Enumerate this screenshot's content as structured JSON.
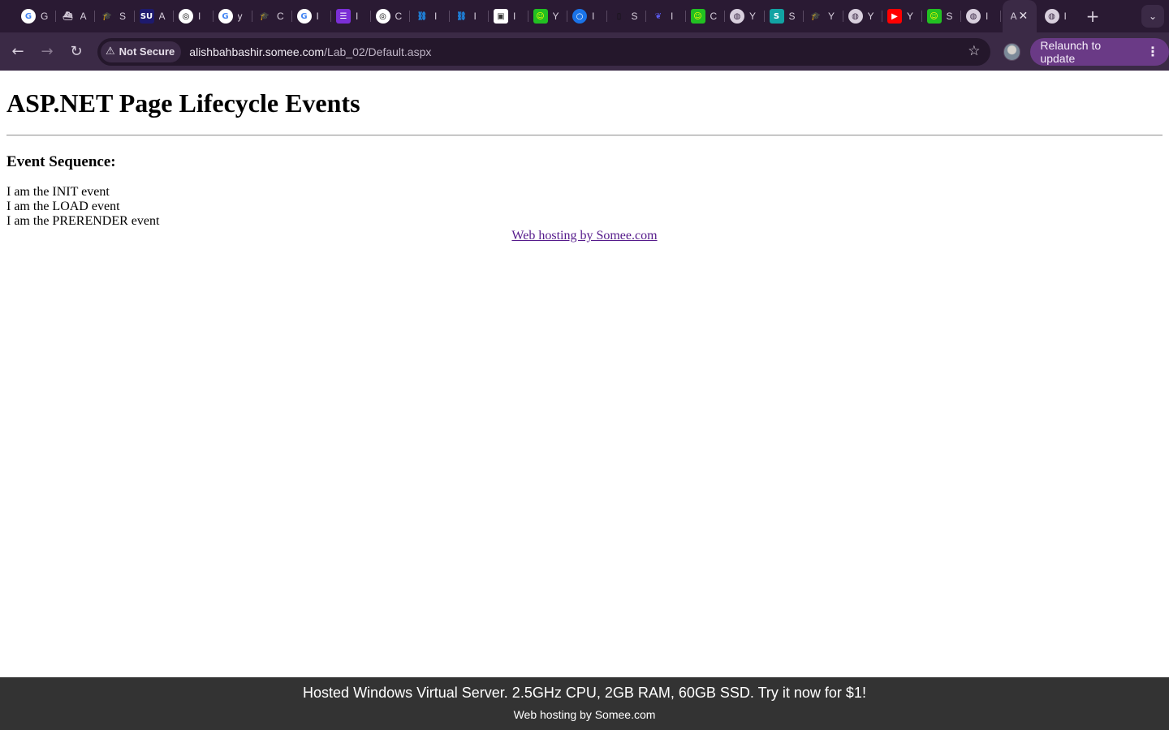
{
  "browser": {
    "tabs": [
      {
        "icon": "google-icon",
        "color": "#ffffff",
        "glyph": "G",
        "fg": "#4285f4",
        "title": "G"
      },
      {
        "icon": "ship-icon",
        "color": "#2a1a33",
        "glyph": "⛴",
        "fg": "#d8cfdd",
        "title": "A"
      },
      {
        "icon": "graduation-cap-icon",
        "color": "#2a1a33",
        "glyph": "🎓",
        "fg": "#2bb3c0",
        "title": "S"
      },
      {
        "icon": "su-logo-icon",
        "color": "#1e1a6e",
        "glyph": "SU",
        "fg": "#ffffff",
        "title": "A"
      },
      {
        "icon": "openai-icon",
        "color": "#ffffff",
        "glyph": "◎",
        "fg": "#000000",
        "title": "I"
      },
      {
        "icon": "google-icon",
        "color": "#ffffff",
        "glyph": "G",
        "fg": "#4285f4",
        "title": "y"
      },
      {
        "icon": "graduation-cap-icon",
        "color": "#2a1a33",
        "glyph": "🎓",
        "fg": "#2bb3c0",
        "title": "C"
      },
      {
        "icon": "google-icon",
        "color": "#ffffff",
        "glyph": "G",
        "fg": "#4285f4",
        "title": "I"
      },
      {
        "icon": "list-icon",
        "color": "#7b2fd6",
        "glyph": "☰",
        "fg": "#ffffff",
        "title": "I"
      },
      {
        "icon": "openai-icon",
        "color": "#ffffff",
        "glyph": "◎",
        "fg": "#000000",
        "title": "C"
      },
      {
        "icon": "link-icon",
        "color": "#2a1a33",
        "glyph": "⛓",
        "fg": "#1e88e5",
        "title": "I"
      },
      {
        "icon": "link-icon",
        "color": "#2a1a33",
        "glyph": "⛓",
        "fg": "#1e88e5",
        "title": "I"
      },
      {
        "icon": "lock-doc-icon",
        "color": "#ffffff",
        "glyph": "▣",
        "fg": "#333333",
        "title": "I"
      },
      {
        "icon": "smiley-icon",
        "color": "#22c022",
        "glyph": "☺",
        "fg": "#ffff00",
        "title": "Y"
      },
      {
        "icon": "circle-icon",
        "color": "#1a73e8",
        "glyph": "○",
        "fg": "#ffffff",
        "title": "I"
      },
      {
        "icon": "file-icon",
        "color": "#2a1a33",
        "glyph": "▯",
        "fg": "#111111",
        "title": "S"
      },
      {
        "icon": "bird-icon",
        "color": "#2a1a33",
        "glyph": "❦",
        "fg": "#5b5bf0",
        "title": "I"
      },
      {
        "icon": "smiley-icon",
        "color": "#22c022",
        "glyph": "☺",
        "fg": "#ffff00",
        "title": "C"
      },
      {
        "icon": "globe-icon",
        "color": "#d8cfdd",
        "glyph": "◍",
        "fg": "#3b2a46",
        "title": "Y"
      },
      {
        "icon": "s-logo-icon",
        "color": "#12a3a3",
        "glyph": "S",
        "fg": "#ffffff",
        "title": "S"
      },
      {
        "icon": "graduation-cap-icon",
        "color": "#2a1a33",
        "glyph": "🎓",
        "fg": "#2bb3c0",
        "title": "Y"
      },
      {
        "icon": "globe-icon",
        "color": "#d8cfdd",
        "glyph": "◍",
        "fg": "#3b2a46",
        "title": "Y"
      },
      {
        "icon": "youtube-icon",
        "color": "#ff0000",
        "glyph": "▶",
        "fg": "#ffffff",
        "title": "Y"
      },
      {
        "icon": "smiley-icon",
        "color": "#22c022",
        "glyph": "☺",
        "fg": "#ffff00",
        "title": "S"
      },
      {
        "icon": "globe-icon",
        "color": "#d8cfdd",
        "glyph": "◍",
        "fg": "#3b2a46",
        "title": "I"
      }
    ],
    "active_tab": {
      "title": "A",
      "close": "✕"
    },
    "after_tab": {
      "icon": "globe-icon",
      "title": "I"
    },
    "new_tab": "+",
    "tab_search": "⌄",
    "nav": {
      "back": "←",
      "forward": "→",
      "reload": "↻"
    },
    "security": {
      "icon": "warning-icon",
      "glyph": "⚠",
      "label": "Not Secure"
    },
    "url": {
      "host": "alishbahbashir.somee.com",
      "path": "/Lab_02/Default.aspx"
    },
    "bookmark_glyph": "☆",
    "relaunch": {
      "label": "Relaunch to update",
      "menu": "⋮"
    }
  },
  "page": {
    "title": "ASP.NET Page Lifecycle Events",
    "section_heading": "Event Sequence:",
    "events": [
      "I am the INIT event",
      "I am the LOAD event",
      "I am the PRERENDER event"
    ],
    "hosting_link": "Web hosting by Somee.com"
  },
  "ad_bar": {
    "ad_text": "Hosted Windows Virtual Server. 2.5GHz CPU, 2GB RAM, 60GB SSD. Try it now for $1!",
    "sub_text": "Web hosting by Somee.com"
  }
}
